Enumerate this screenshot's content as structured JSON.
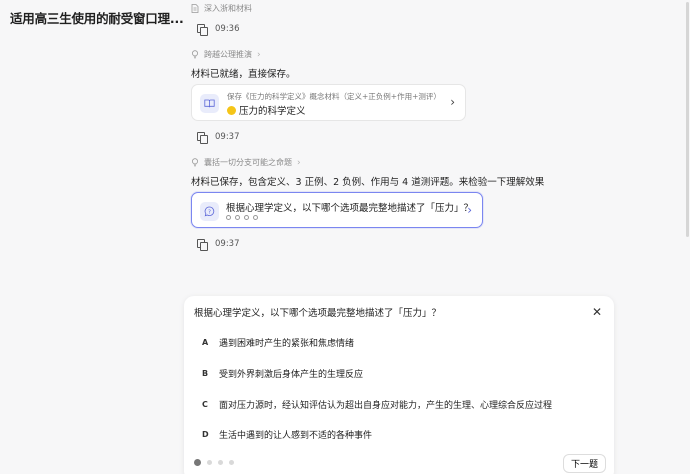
{
  "header": {
    "title": "适用高三生使用的耐受窗口理..."
  },
  "thread": {
    "step0_label": "深入浙和材料",
    "time0": "09:36",
    "step1_label": "跨越公理推演",
    "msg1": "材料已就绪，直接保存。",
    "card1": {
      "subtitle": "保存《压力的科学定义》概念材料（定义+正负例+作用+测评）",
      "title": "压力的科学定义"
    },
    "time1": "09:37",
    "step2_label": "囊括一切分支可能之命题",
    "msg2": "材料已保存，包含定义、3 正例、2 负例、作用与 4 道测评题。来检验一下理解效果",
    "card2": {
      "title": "根据心理学定义，以下哪个选项最完整地描述了「压力」？"
    },
    "time2": "09:37"
  },
  "quiz": {
    "question": "根据心理学定义，以下哪个选项最完整地描述了「压力」？",
    "options": [
      {
        "letter": "A",
        "text": "遇到困难时产生的紧张和焦虑情绪"
      },
      {
        "letter": "B",
        "text": "受到外界刺激后身体产生的生理反应"
      },
      {
        "letter": "C",
        "text": "面对压力源时，经认知评估认为超出自身应对能力，产生的生理、心理综合反应过程"
      },
      {
        "letter": "D",
        "text": "生活中遇到的让人感到不适的各种事件"
      }
    ],
    "next_label": "下一题",
    "current_page": 1,
    "total_pages": 4
  },
  "icons": {
    "step0": "document-icon",
    "steps": "lightbulb-icon",
    "card1": "book-icon",
    "card2": "chat-question-icon",
    "copy": "copy-icon",
    "close": "close-icon"
  },
  "colors": {
    "accent": "#7b86f0",
    "icon_bg": "#e9ecfb",
    "page_bg": "#f7f7f8"
  }
}
